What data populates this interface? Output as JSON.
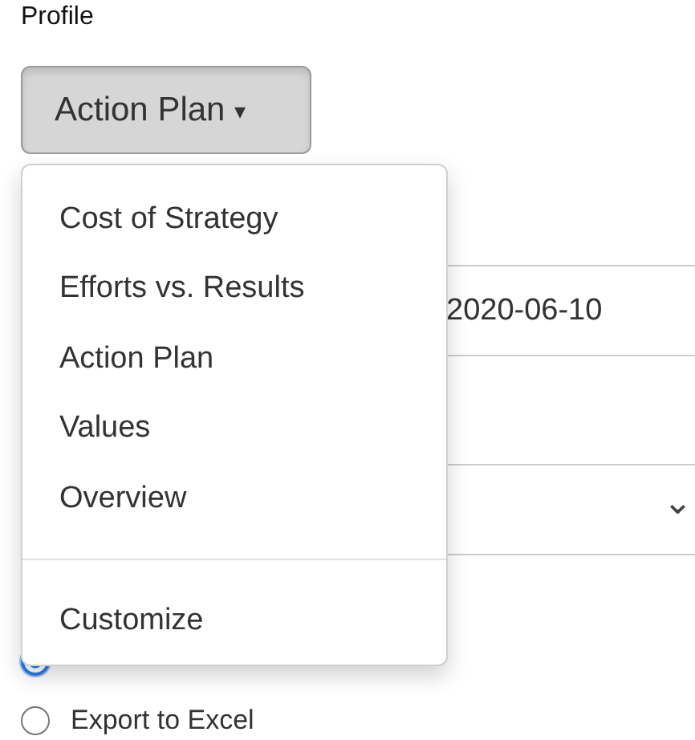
{
  "profile": {
    "label": "Profile",
    "button": {
      "label": "Action Plan",
      "caret": "▾",
      "expanded": true
    }
  },
  "menu": {
    "items": [
      {
        "kind": "item",
        "label": "Cost of Strategy"
      },
      {
        "kind": "item",
        "label": "Efforts vs. Results"
      },
      {
        "kind": "item",
        "label": "Action Plan"
      },
      {
        "kind": "item",
        "label": "Values"
      },
      {
        "kind": "item",
        "label": "Overview"
      },
      {
        "kind": "divider"
      },
      {
        "kind": "item",
        "label": "Customize"
      }
    ]
  },
  "date_field": {
    "value": "2020-06-10"
  },
  "select_field": {
    "chevron": "⌄"
  },
  "export_options": [
    {
      "selected": true
    },
    {
      "label": "Export to Excel",
      "selected": false
    }
  ]
}
